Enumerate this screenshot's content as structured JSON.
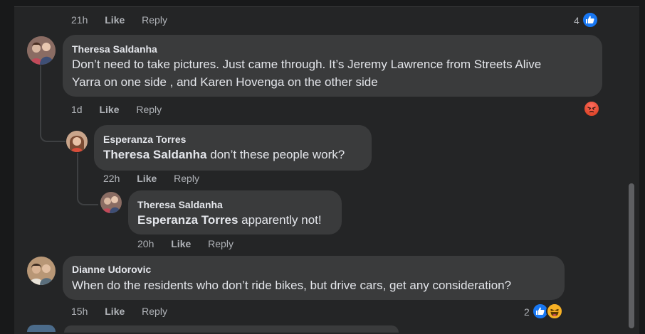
{
  "top_meta": {
    "time": "21h",
    "like": "Like",
    "reply": "Reply",
    "reaction_count": "4",
    "reactions": [
      "like-icon"
    ]
  },
  "comments": [
    {
      "author": "Theresa Saldanha",
      "text_line1": "Don’t need to take pictures. Just came through. It’s Jeremy Lawrence from Streets Alive",
      "text_line2": "Yarra on one side , and Karen Hovenga on the other side",
      "time": "1d",
      "like": "Like",
      "reply": "Reply",
      "reactions": [
        "angry-icon"
      ]
    },
    {
      "author": "Esperanza Torres",
      "mention": "Theresa Saldanha",
      "text": " don’t these people work?",
      "time": "22h",
      "like": "Like",
      "reply": "Reply"
    },
    {
      "author": "Theresa Saldanha",
      "mention": "Esperanza Torres",
      "text": " apparently not!",
      "time": "20h",
      "like": "Like",
      "reply": "Reply"
    },
    {
      "author": "Dianne Udorovic",
      "text": "When do the residents who don’t ride bikes, but drive cars, get any consideration?",
      "time": "15h",
      "like": "Like",
      "reply": "Reply",
      "reaction_count": "2",
      "reactions": [
        "like-icon",
        "haha-icon"
      ]
    }
  ],
  "colors": {
    "background": "#242526",
    "bubble": "#3a3b3c",
    "like_blue": "#1877f2",
    "meta_text": "#b0b3b8"
  }
}
